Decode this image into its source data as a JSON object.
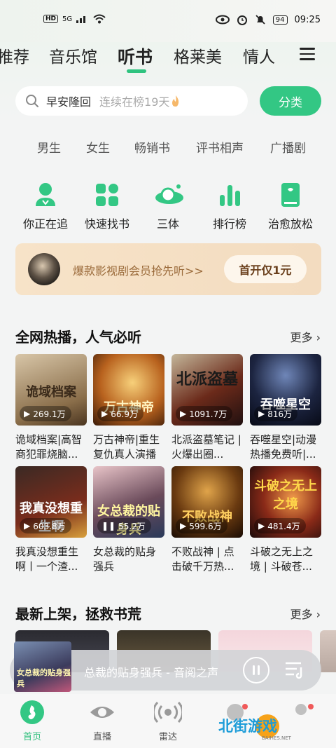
{
  "status_bar": {
    "hd": "HD",
    "signal": "5G",
    "battery": "94",
    "time": "09:25"
  },
  "nav": {
    "tabs": [
      "推荐",
      "音乐馆",
      "听书",
      "格莱美",
      "情人"
    ],
    "active_tab": "听书"
  },
  "search": {
    "query": "早安隆回",
    "hint": "连续在榜19天"
  },
  "category_button": "分类",
  "sub_categories": [
    "男生",
    "女生",
    "畅销书",
    "评书相声",
    "广播剧"
  ],
  "quick_links": [
    "你正在追",
    "快速找书",
    "三体",
    "排行榜",
    "治愈放松"
  ],
  "vip_banner": {
    "text": "爆款影视剧会员抢先听>>",
    "button": "首开仅1元"
  },
  "hot_section": {
    "title": "全网热播，人气必听",
    "more": "更多",
    "books": [
      {
        "cover_text": "诡域档案",
        "plays": "269.1万",
        "title": "诡域档案|高智商犯罪烧脑..."
      },
      {
        "cover_text": "万古神帝",
        "plays": "66.9万",
        "title": "万古神帝|重生复仇真人演播"
      },
      {
        "cover_text": "北派盗墓",
        "plays": "1091.7万",
        "title": "北派盗墓笔记 | 火爆出圈..."
      },
      {
        "cover_text": "吞噬星空",
        "plays": "816万",
        "title": "吞噬星空|动漫热播免费听|..."
      },
      {
        "cover_text": "我真没想重生啊",
        "plays": "603.8万",
        "title": "我真没想重生啊丨一个渣..."
      },
      {
        "cover_text": "女总裁的贴身兵",
        "plays": "55.2万",
        "title": "女总裁的贴身强兵"
      },
      {
        "cover_text": "不败战神",
        "plays": "599.6万",
        "title": "不败战神 | 点击破千万热..."
      },
      {
        "cover_text": "斗破之无上之境",
        "plays": "481.4万",
        "title": "斗破之无上之境 | 斗破苍..."
      }
    ]
  },
  "new_section": {
    "title": "最新上架，拯救书荒",
    "more": "更多"
  },
  "player": {
    "cover_text": "女总裁的贴身强兵",
    "title": "总裁的贴身强兵 - 音阅之声"
  },
  "bottom_nav": [
    "首页",
    "直播",
    "雷达"
  ],
  "watermark": {
    "text": "北街游戏",
    "sub": "BAIHES.NET"
  },
  "colors": {
    "accent": "#33c784",
    "vip_text": "#9a6a3a"
  }
}
